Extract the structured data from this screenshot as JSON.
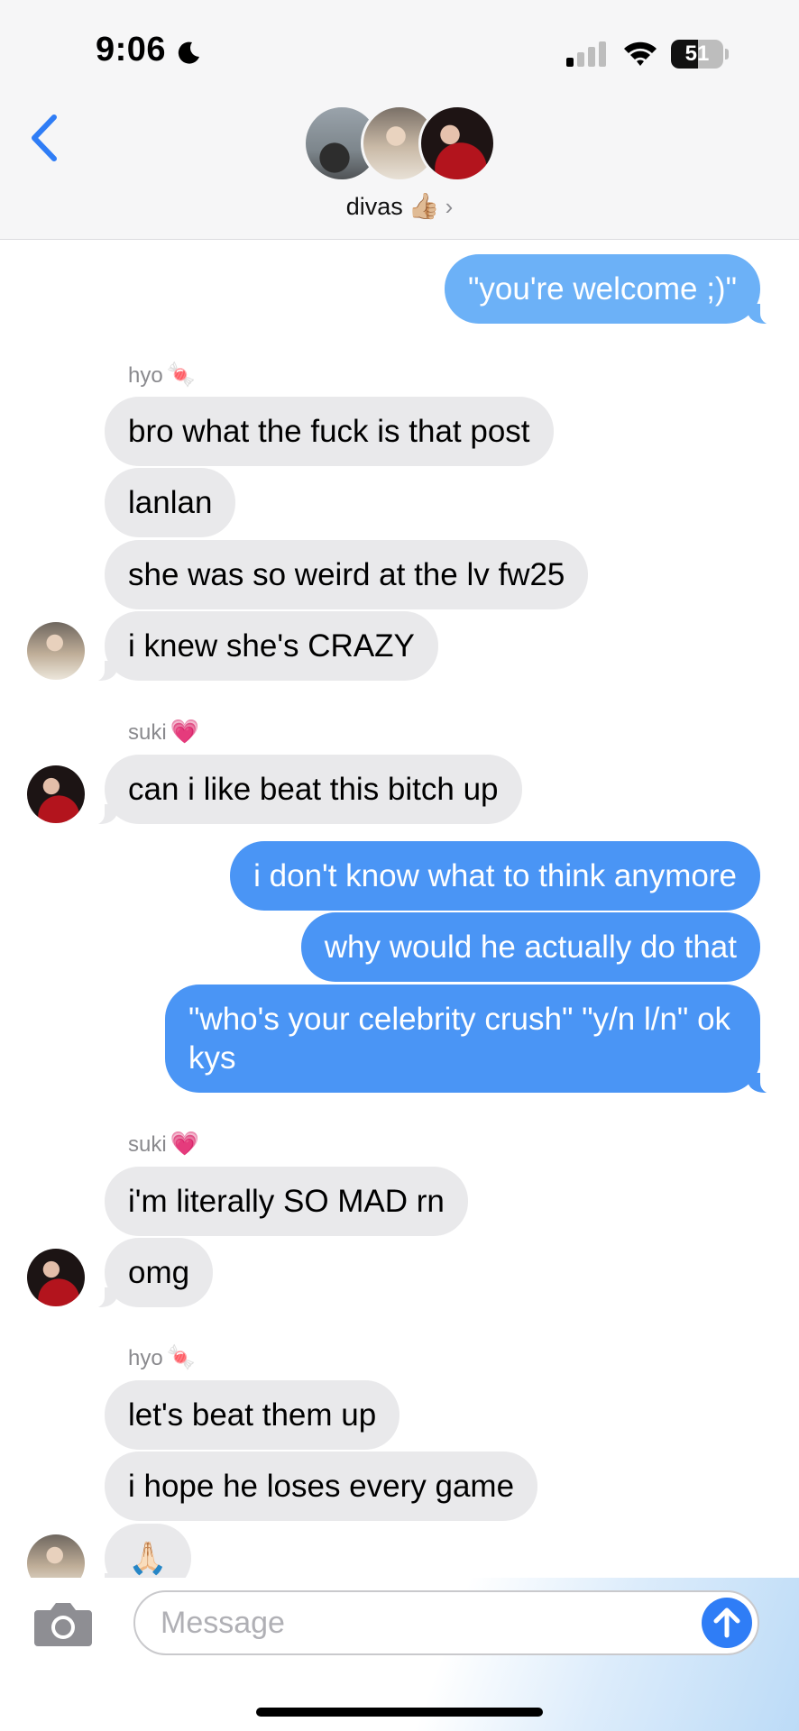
{
  "status_bar": {
    "time": "9:06",
    "battery_level": "51",
    "icons": [
      "moon-icon",
      "signal-icon",
      "wifi-icon",
      "battery-icon"
    ]
  },
  "header": {
    "group_name": "divas",
    "group_emoji": "👍🏼",
    "chevron": "›",
    "back_icon": "chevron-left-icon"
  },
  "messages": {
    "m1": "\"you're welcome ;)\"",
    "s1_name": "hyo",
    "s1_emoji": "🍬",
    "m2": "bro what the fuck is that post",
    "m3": "lanlan",
    "m4": "she was so weird at the lv fw25",
    "m5": "i knew she's CRAZY",
    "s2_name": "suki",
    "s2_emoji": "💗",
    "m6": "can i like beat this bitch up",
    "m7": "i don't know what to think anymore",
    "m8": "why would he actually do that",
    "m9": "\"who's your celebrity crush\" \"y/n l/n\" ok kys",
    "s3_name": "suki",
    "s3_emoji": "💗",
    "m10": "i'm literally SO MAD rn",
    "m11": "omg",
    "s4_name": "hyo",
    "s4_emoji": "🍬",
    "m12": "let's beat them up",
    "m13": "i hope he loses every game",
    "m14": "🙏🏻"
  },
  "input_bar": {
    "placeholder": "Message",
    "camera_icon": "camera-icon",
    "send_icon": "arrow-up-icon"
  },
  "colors": {
    "outgoing_bubble": "#4a95f5",
    "incoming_bubble": "#e9e9eb",
    "accent": "#2f7df6"
  }
}
